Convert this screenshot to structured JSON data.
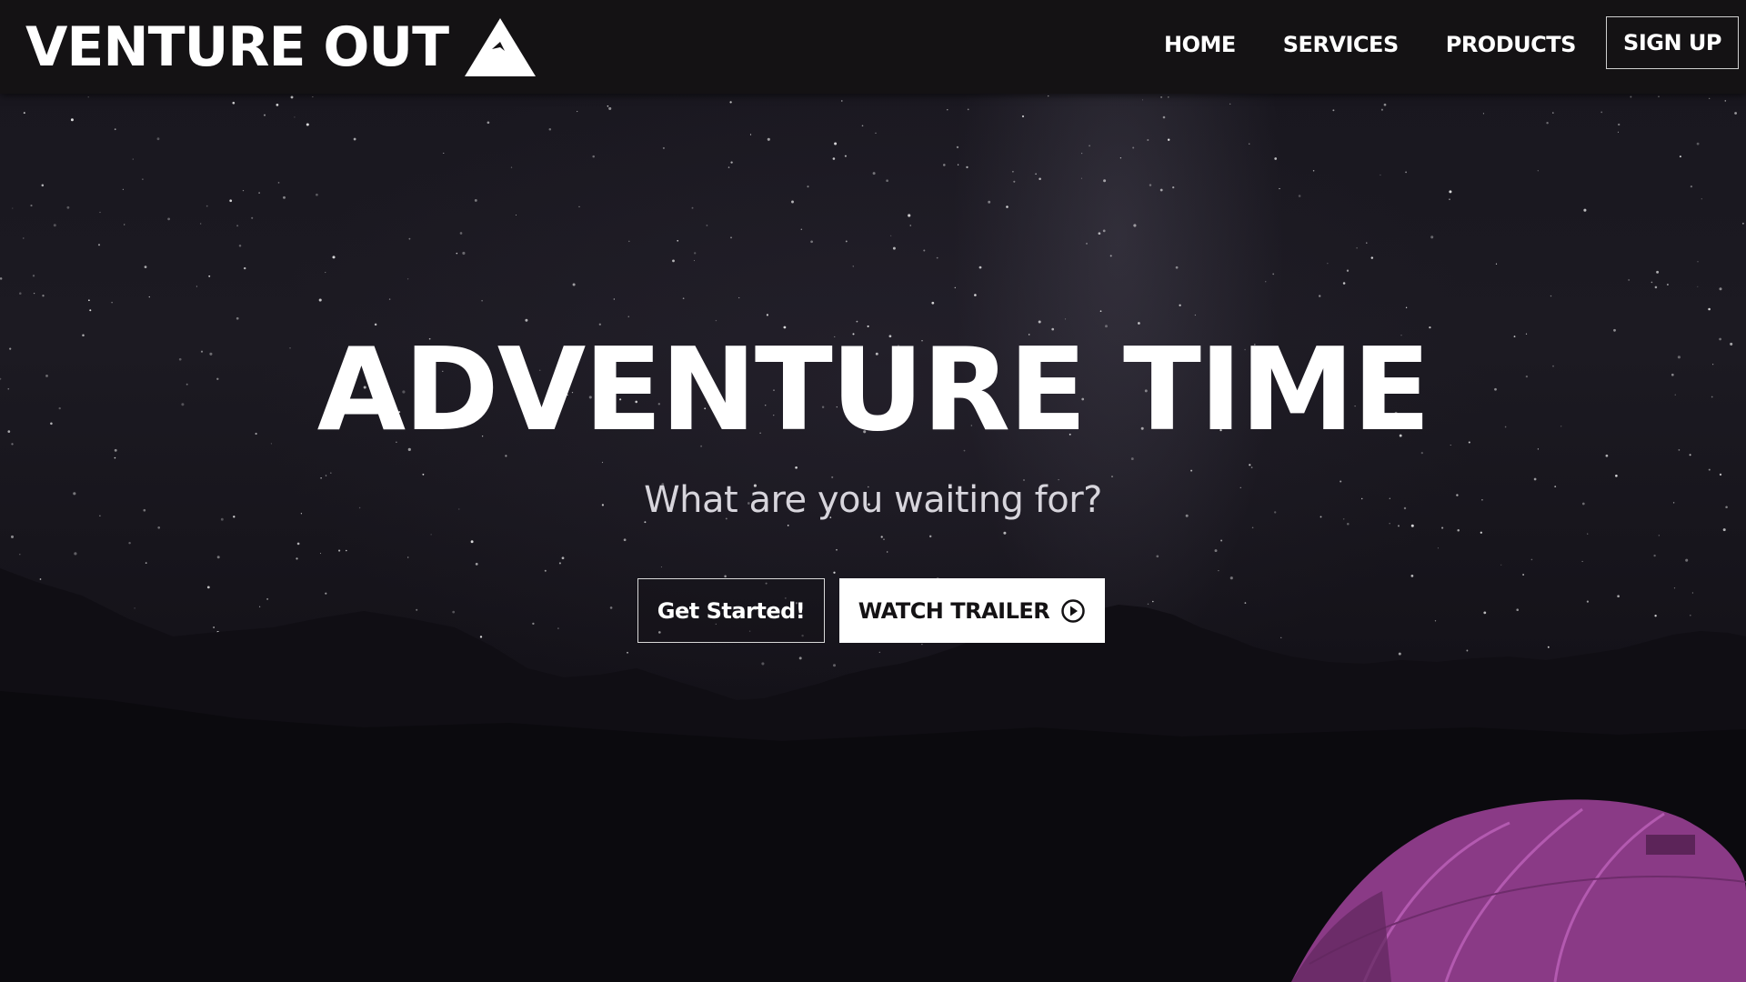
{
  "navbar": {
    "brand": "VENTURE OUT",
    "logo_icon": "mountain-icon",
    "links": [
      "HOME",
      "SERVICES",
      "PRODUCTS"
    ],
    "signup_label": "SIGN UP"
  },
  "hero": {
    "title": "ADVENTURE TIME",
    "subtitle": "What are you waiting for?",
    "primary_button": "Get Started!",
    "secondary_button": "WATCH TRAILER",
    "secondary_icon": "play-circle-icon"
  },
  "colors": {
    "navbar_bg": "#141214",
    "text": "#ffffff",
    "tent": "#8a3a86"
  }
}
